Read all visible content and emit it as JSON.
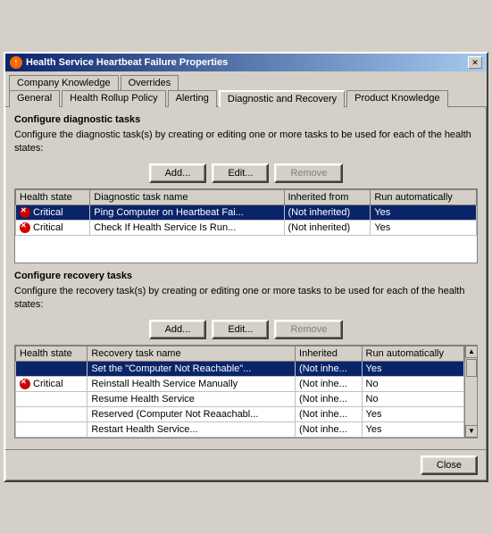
{
  "window": {
    "title": "Health Service Heartbeat Failure Properties",
    "close_label": "✕"
  },
  "tabs_row1": {
    "items": [
      {
        "label": "Company Knowledge",
        "active": false
      },
      {
        "label": "Overrides",
        "active": false
      }
    ]
  },
  "tabs_row2": {
    "items": [
      {
        "label": "General",
        "active": false
      },
      {
        "label": "Health Rollup Policy",
        "active": false
      },
      {
        "label": "Alerting",
        "active": false
      },
      {
        "label": "Diagnostic and Recovery",
        "active": true
      },
      {
        "label": "Product Knowledge",
        "active": false
      }
    ]
  },
  "diagnostic": {
    "section_title": "Configure diagnostic tasks",
    "description": "Configure the diagnostic task(s) by creating or editing one or more tasks to be used for each of the health states:",
    "buttons": {
      "add": "Add...",
      "edit": "Edit...",
      "remove": "Remove"
    },
    "table": {
      "headers": [
        "Health state",
        "Diagnostic task name",
        "Inherited from",
        "Run automatically"
      ],
      "rows": [
        {
          "health_state": "Critical",
          "task_name": "Ping Computer on Heartbeat Fai...",
          "inherited_from": "(Not inherited)",
          "run_auto": "Yes",
          "selected": true,
          "has_icon": true
        },
        {
          "health_state": "Critical",
          "task_name": "Check If Health Service Is Run...",
          "inherited_from": "(Not inherited)",
          "run_auto": "Yes",
          "selected": false,
          "has_icon": true
        }
      ]
    }
  },
  "recovery": {
    "section_title": "Configure recovery tasks",
    "description": "Configure the recovery task(s) by creating or editing one or more tasks to be used for each of the health states:",
    "buttons": {
      "add": "Add...",
      "edit": "Edit...",
      "remove": "Remove"
    },
    "table": {
      "headers": [
        "Health state",
        "Recovery task name",
        "Inherited",
        "Run automatically"
      ],
      "rows": [
        {
          "health_state": "",
          "task_name": "Set the \"Computer Not Reachable\"...",
          "inherited_from": "(Not inhe...",
          "run_auto": "Yes",
          "selected": true,
          "has_icon": false
        },
        {
          "health_state": "Critical",
          "task_name": "Reinstall Health Service Manually",
          "inherited_from": "(Not inhe...",
          "run_auto": "No",
          "selected": false,
          "has_icon": true
        },
        {
          "health_state": "",
          "task_name": "Resume Health Service",
          "inherited_from": "(Not inhe...",
          "run_auto": "No",
          "selected": false,
          "has_icon": false
        },
        {
          "health_state": "",
          "task_name": "Reserved (Computer Not Reaachabl...",
          "inherited_from": "(Not inhe...",
          "run_auto": "Yes",
          "selected": false,
          "has_icon": false
        },
        {
          "health_state": "",
          "task_name": "Restart Health Service...",
          "inherited_from": "(Not inhe...",
          "run_auto": "Yes",
          "selected": false,
          "has_icon": false
        }
      ]
    }
  },
  "footer": {
    "close_label": "Close"
  }
}
